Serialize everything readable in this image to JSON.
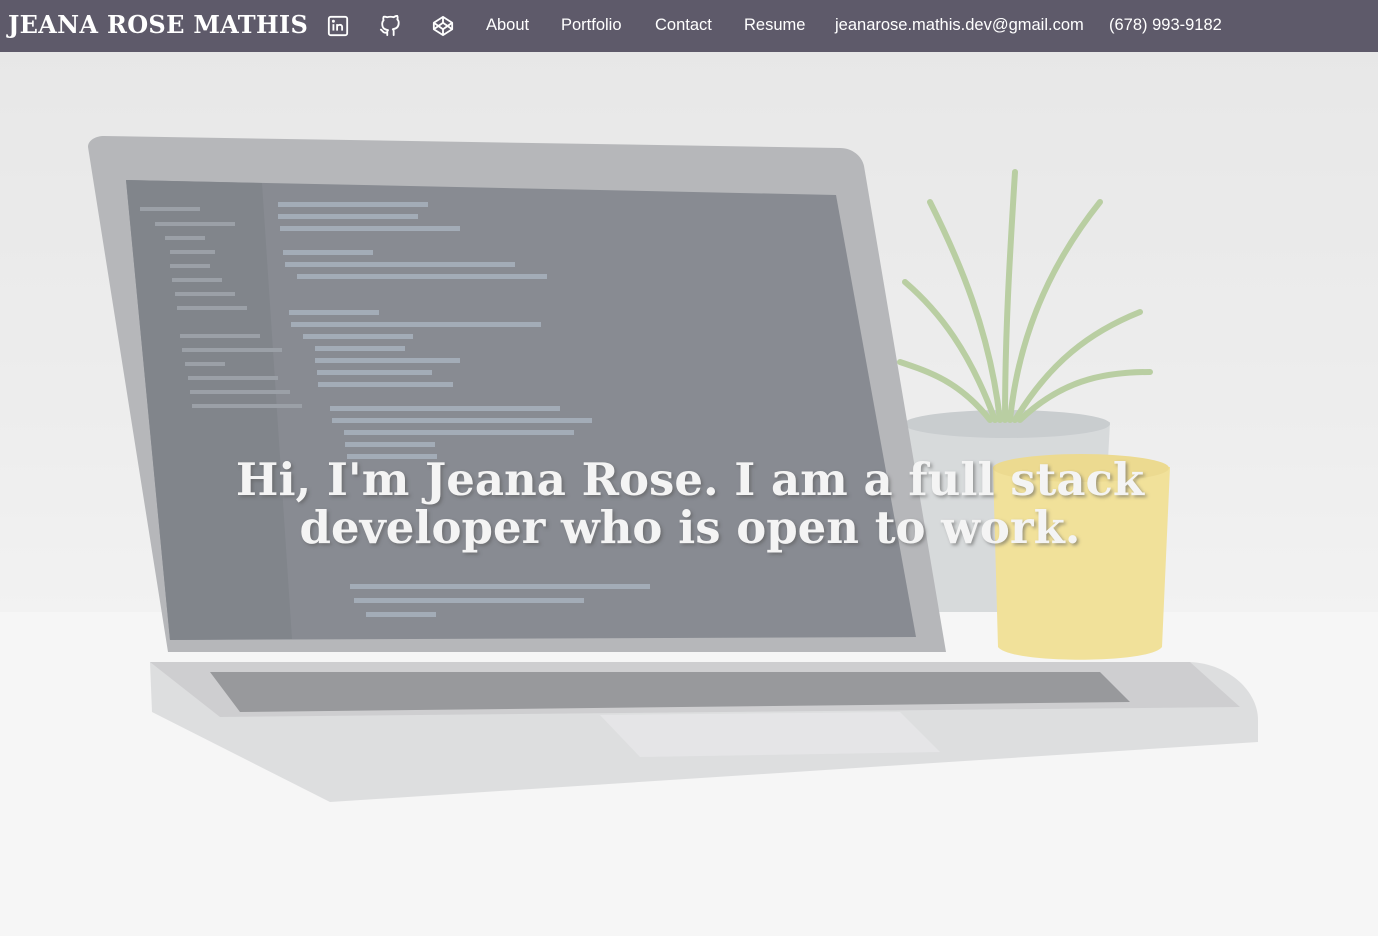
{
  "nav": {
    "brand": "JEANA ROSE MATHIS",
    "icons": [
      {
        "name": "linkedin-icon",
        "semantic": "linkedin"
      },
      {
        "name": "github-icon",
        "semantic": "github"
      },
      {
        "name": "codepen-icon",
        "semantic": "codepen"
      }
    ],
    "links": {
      "about": "About",
      "portfolio": "Portfolio",
      "contact": "Contact",
      "resume": "Resume",
      "email": "jeanarose.mathis.dev@gmail.com",
      "phone": "(678) 993-9182"
    }
  },
  "hero": {
    "heading": "Hi, I'm Jeana Rose. I am a full stack developer who is open to work."
  },
  "colors": {
    "navbar": "#5e5a6a",
    "nav_text": "#ffffff",
    "hero_text": "#f4f4f4"
  }
}
